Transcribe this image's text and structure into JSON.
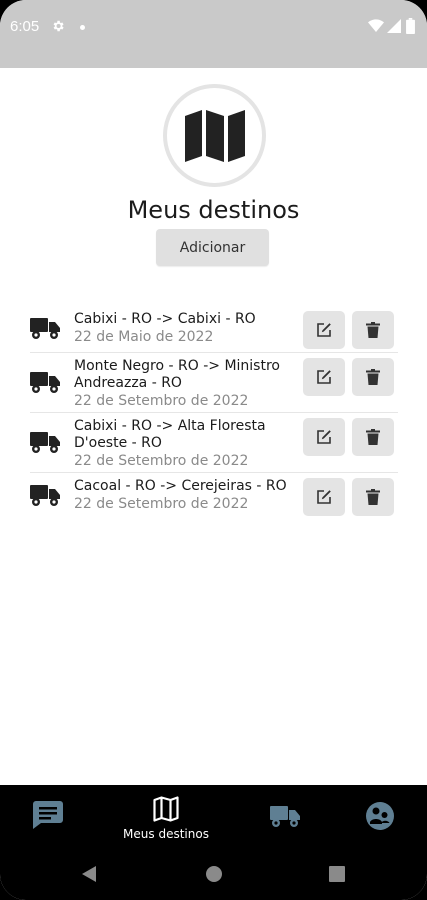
{
  "status_bar": {
    "time": "6:05",
    "icons": [
      "gear-icon",
      "dot-icon",
      "wifi-icon",
      "signal-icon",
      "battery-icon"
    ]
  },
  "header": {
    "icon": "map-icon",
    "title": "Meus destinos",
    "add_button_label": "Adicionar"
  },
  "destinations": [
    {
      "route": "Cabixi - RO -> Cabixi - RO",
      "date": "22 de Maio de 2022"
    },
    {
      "route": "Monte Negro - RO -> Ministro Andreazza - RO",
      "date": "22 de Setembro de 2022"
    },
    {
      "route": "Cabixi - RO -> Alta Floresta D'oeste - RO",
      "date": "22 de Setembro de 2022"
    },
    {
      "route": "Cacoal - RO -> Cerejeiras - RO",
      "date": "22 de Setembro de 2022"
    }
  ],
  "bottom_nav": {
    "items": [
      {
        "icon": "chat-icon",
        "label": ""
      },
      {
        "icon": "map-icon",
        "label": "Meus destinos",
        "active": true
      },
      {
        "icon": "truck-icon",
        "label": ""
      },
      {
        "icon": "profile-icon",
        "label": ""
      }
    ],
    "active_color": "#ffffff",
    "inactive_color": "#5f7f93"
  },
  "colors": {
    "status_bar": "#c9c9c9",
    "button_bg": "#e0e0e0",
    "text_primary": "#1b1b1b",
    "text_secondary": "#8a8a8a"
  }
}
